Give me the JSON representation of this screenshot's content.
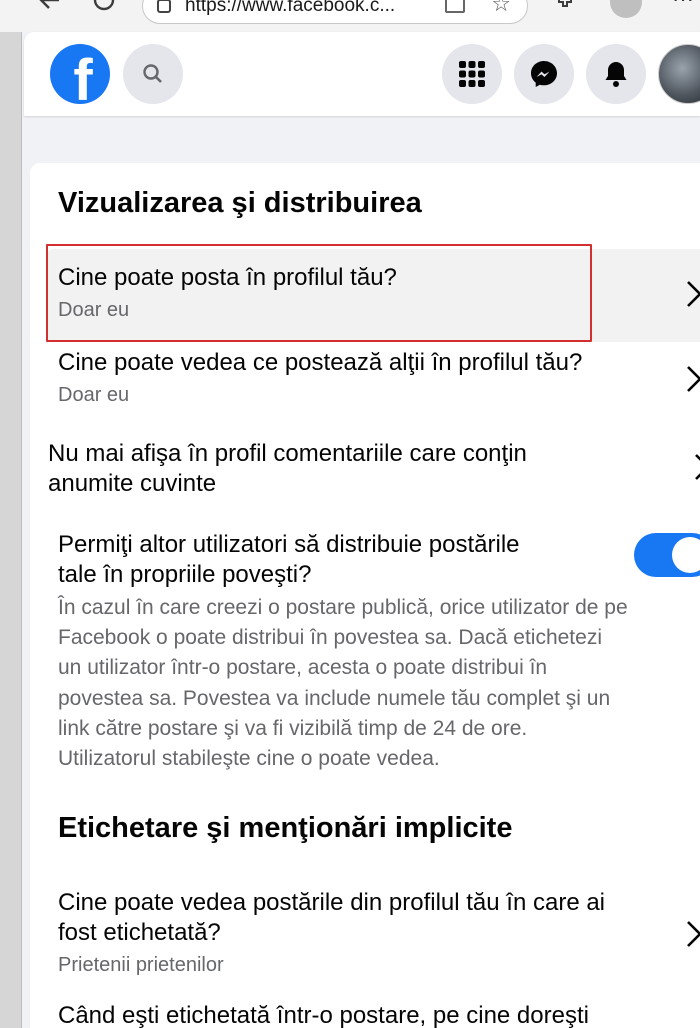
{
  "browser": {
    "url": "https://www.facebook.c...",
    "back_icon": "back-arrow-icon",
    "refresh_icon": "refresh-icon"
  },
  "header": {
    "logo": "f",
    "icons": [
      "search-icon",
      "menu-grid-icon",
      "messenger-icon",
      "notifications-bell-icon",
      "profile-avatar"
    ]
  },
  "sections": {
    "viewing": {
      "title": "Vizualizarea şi distribuirea",
      "items": [
        {
          "title": "Cine poate posta în profilul tău?",
          "value": "Doar eu"
        },
        {
          "title": "Cine poate vedea ce postează alţii în profilul tău?",
          "value": "Doar eu"
        }
      ],
      "hide_comments_line1": "Nu mai afişa în profil comentariile care conţin",
      "hide_comments_line2": "anumite cuvinte",
      "share_title_line1": "Permiţi altor utilizatori să distribuie postările",
      "share_title_line2": "tale în propriile poveşti?",
      "share_description": "În cazul în care creezi o postare publică, orice utilizator de pe Facebook o poate distribui în povestea sa. Dacă etichetezi un utilizator într-o postare, acesta o poate distribui în povestea sa. Povestea va include numele tău complet şi un link către postare şi va fi vizibilă timp de 24 de ore. Utilizatorul stabileşte cine o poate vedea.",
      "share_enabled": true
    },
    "tagging": {
      "title": "Etichetare şi menţionări implicite",
      "items": [
        {
          "title_line1": "Cine poate vedea postările din profilul tău în care ai",
          "title_line2": "fost etichetată?",
          "value": "Prietenii prietenilor"
        }
      ],
      "next_item_partial": "Când eşti etichetată într-o postare, pe cine doreşti"
    }
  },
  "colors": {
    "brand": "#1877f2",
    "highlight_border": "#d32f2f",
    "secondary_text": "#65676b"
  }
}
